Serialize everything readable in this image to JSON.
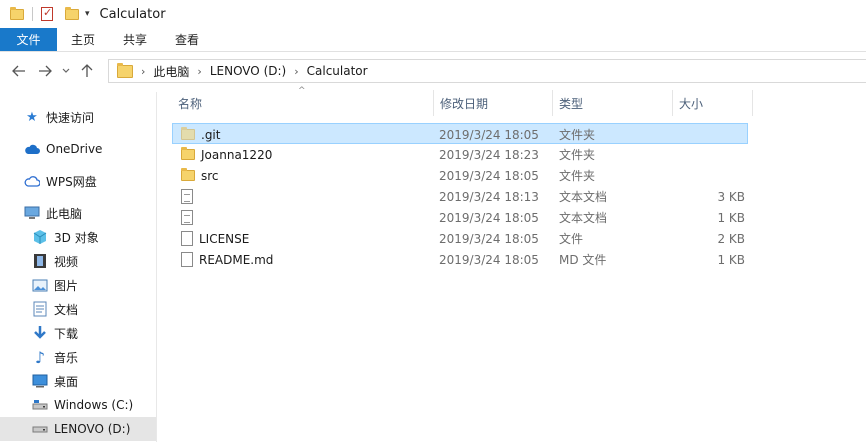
{
  "window": {
    "title": "Calculator"
  },
  "ribbon": {
    "tabs": [
      {
        "label": "文件"
      },
      {
        "label": "主页"
      },
      {
        "label": "共享"
      },
      {
        "label": "查看"
      }
    ]
  },
  "address": {
    "crumbs": [
      "此电脑",
      "LENOVO (D:)",
      "Calculator"
    ]
  },
  "nav": {
    "quick_access": "快速访问",
    "onedrive": "OneDrive",
    "wps": "WPS网盘",
    "this_pc": "此电脑",
    "objects3d": "3D 对象",
    "videos": "视频",
    "pictures": "图片",
    "documents": "文档",
    "downloads": "下载",
    "music": "音乐",
    "desktop": "桌面",
    "drive_c": "Windows (C:)",
    "drive_d": "LENOVO (D:)"
  },
  "columns": {
    "name": "名称",
    "modified": "修改日期",
    "type": "类型",
    "size": "大小"
  },
  "files": [
    {
      "name": ".git",
      "modified": "2019/3/24 18:05",
      "type": "文件夹",
      "size": ""
    },
    {
      "name": "Joanna1220",
      "modified": "2019/3/24 18:23",
      "type": "文件夹",
      "size": ""
    },
    {
      "name": "src",
      "modified": "2019/3/24 18:05",
      "type": "文件夹",
      "size": ""
    },
    {
      "name": "",
      "modified": "2019/3/24 18:13",
      "type": "文本文档",
      "size": "3 KB"
    },
    {
      "name": "",
      "modified": "2019/3/24 18:05",
      "type": "文本文档",
      "size": "1 KB"
    },
    {
      "name": "LICENSE",
      "modified": "2019/3/24 18:05",
      "type": "文件",
      "size": "2 KB"
    },
    {
      "name": "README.md",
      "modified": "2019/3/24 18:05",
      "type": "MD 文件",
      "size": "1 KB"
    }
  ]
}
